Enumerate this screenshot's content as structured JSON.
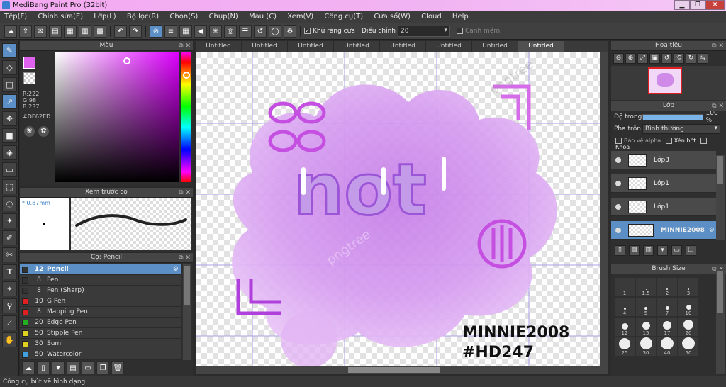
{
  "window": {
    "title": "MediBang Paint Pro (32bit)"
  },
  "menu": [
    "Tệp(F)",
    "Chỉnh sửa(E)",
    "Lớp(L)",
    "Bộ lọc(R)",
    "Chọn(S)",
    "Chụp(N)",
    "Màu (C)",
    "Xem(V)",
    "Công cụ(T)",
    "Cửa sổ(W)",
    "Cloud",
    "Help"
  ],
  "toolbar": {
    "antialias_label": "Khử răng cưa",
    "adjust_label": "Điều chỉnh",
    "adjust_value": "20",
    "snap_label": "Cạnh mềm"
  },
  "color_panel": {
    "title": "Màu",
    "r": "R:222",
    "g": "G:98",
    "b": "B:237",
    "hex": "#DE62ED",
    "fg_color": "#de62ed"
  },
  "brush_preview": {
    "title": "Xem trước cọ",
    "size": "0.87mm"
  },
  "brush_panel": {
    "title": "Cọ: Pencil",
    "items": [
      {
        "size": "12",
        "name": "Pencil",
        "color": "#333333"
      },
      {
        "size": "8",
        "name": "Pen",
        "color": "#333333"
      },
      {
        "size": "8",
        "name": "Pen (Sharp)",
        "color": "#333333"
      },
      {
        "size": "10",
        "name": "G Pen",
        "color": "#e02020"
      },
      {
        "size": "8",
        "name": "Mapping Pen",
        "color": "#e02020"
      },
      {
        "size": "20",
        "name": "Edge Pen",
        "color": "#20b020"
      },
      {
        "size": "50",
        "name": "Stipple Pen",
        "color": "#e0d020"
      },
      {
        "size": "30",
        "name": "Sumi",
        "color": "#e0d020"
      },
      {
        "size": "50",
        "name": "Watercolor",
        "color": "#40a0e0"
      }
    ]
  },
  "tabs": [
    "Untitled",
    "Untitled",
    "Untitled",
    "Untitled",
    "Untitled",
    "Untitled",
    "Untitled",
    "Untitled"
  ],
  "artwork": {
    "word": "not",
    "signature_line1": "MINNIE2008",
    "signature_line2": "#HD247",
    "watermark": "pngtree"
  },
  "navigator": {
    "title": "Hoa tiêu"
  },
  "layers": {
    "title": "Lớp",
    "opacity_label": "Độ trong",
    "opacity_value": "100 %",
    "blend_label": "Pha trộn",
    "blend_value": "Bình thường",
    "protect_alpha": "Bảo vệ alpha",
    "clip_label": "Xén bớt",
    "lock_label": "Khóa",
    "items": [
      {
        "name": "Lớp3"
      },
      {
        "name": "Lớp1"
      },
      {
        "name": "Lớp1"
      },
      {
        "name": "MINNIE2008"
      }
    ]
  },
  "brush_size": {
    "title": "Brush Size",
    "sizes": [
      "1",
      "1.5",
      "2",
      "3",
      "4",
      "5",
      "7",
      "10",
      "12",
      "15",
      "17",
      "20",
      "25",
      "30",
      "40",
      "50",
      "70"
    ]
  },
  "status": {
    "text": "Công cụ bút vẽ hình dạng"
  }
}
